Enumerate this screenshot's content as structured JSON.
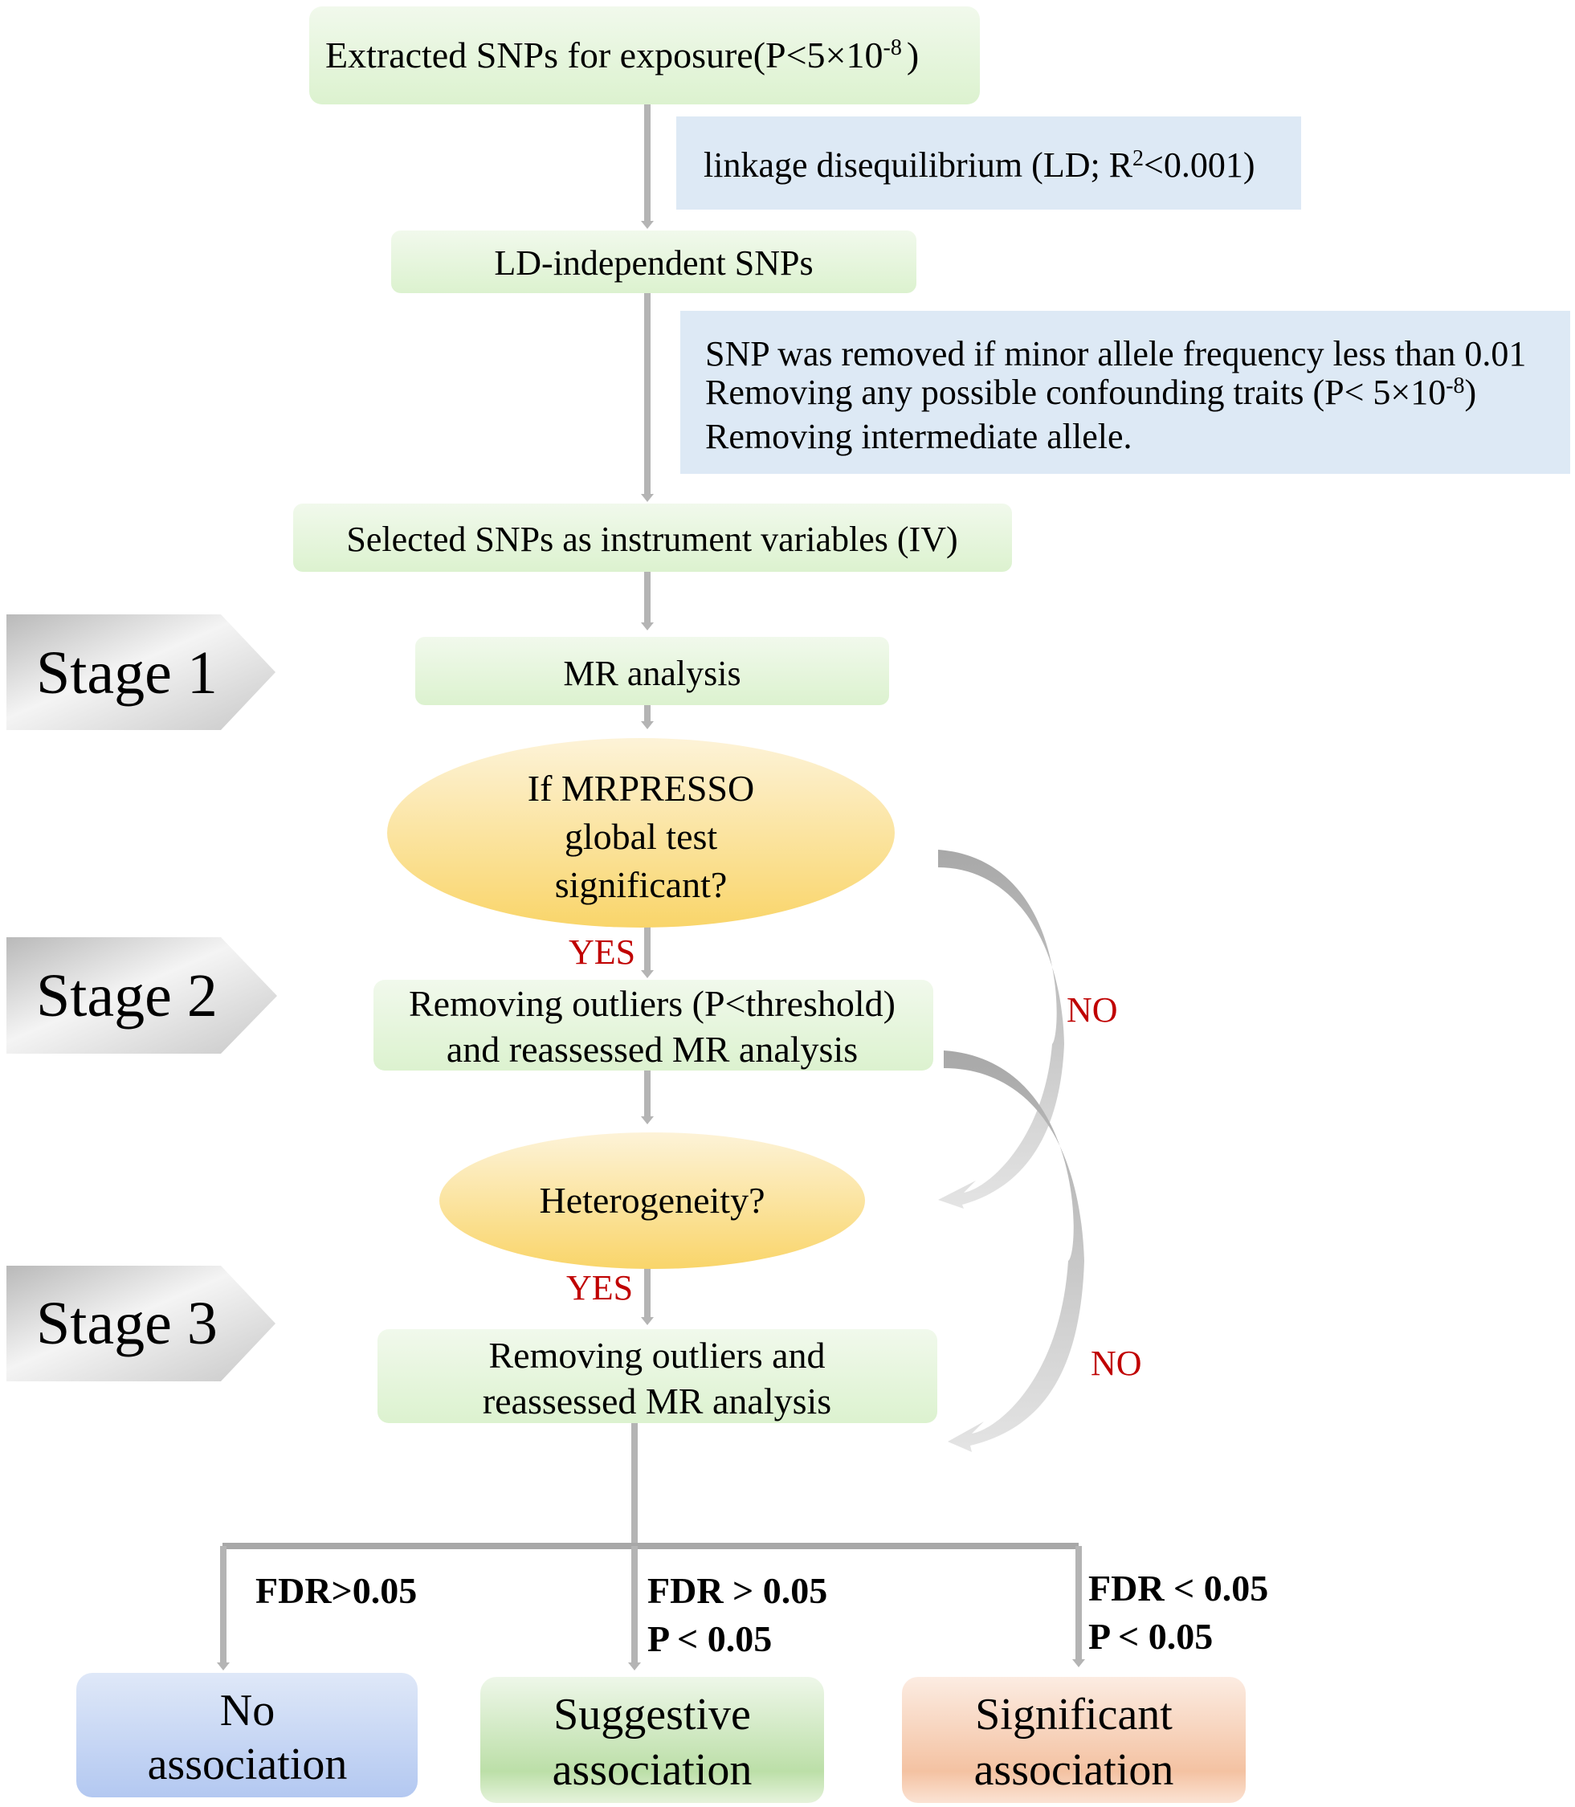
{
  "flow": {
    "extract": {
      "text": "Extracted SNPs for exposure(P<5×10",
      "sup": "-8",
      "tail": ")"
    },
    "ld_note": {
      "text": "linkage disequilibrium (LD; R",
      "sup": "2",
      "tail": "<0.001)"
    },
    "ld_independent": "LD-independent SNPs",
    "filter_note": {
      "line1": "SNP was removed if minor allele frequency less than 0.01",
      "line2": {
        "text": "Removing any possible confounding traits (P< 5×10",
        "sup": "-8",
        "tail": ")"
      },
      "line3": "Removing intermediate allele."
    },
    "selected_iv": "Selected SNPs as instrument variables (IV)",
    "mr_analysis": "MR analysis",
    "mrpresso": {
      "line1": "If MRPRESSO",
      "line2": "global test",
      "line3": "significant?"
    },
    "yes1": "YES",
    "no1": "NO",
    "remove_outliers_1": {
      "line1": "Removing outliers (P<threshold)",
      "line2": "and reassessed MR analysis"
    },
    "heterogeneity": "Heterogeneity?",
    "yes2": "YES",
    "no2": "NO",
    "remove_outliers_2": {
      "line1": "Removing outliers and",
      "line2": "reassessed MR analysis"
    }
  },
  "stages": [
    "Stage 1",
    "Stage 2",
    "Stage 3"
  ],
  "branches": [
    {
      "cond1": "FDR>0.05",
      "cond2": "",
      "result1": "No",
      "result2": "association"
    },
    {
      "cond1": "FDR > 0.05",
      "cond2": "P < 0.05",
      "result1": "Suggestive",
      "result2": "association"
    },
    {
      "cond1": "FDR < 0.05",
      "cond2": "P < 0.05",
      "result1": "Significant",
      "result2": "association"
    }
  ],
  "colors": {
    "process_box": "#e3f4d8",
    "note_box": "#dde9f5",
    "decision": "#fbd971",
    "arrow": "#b4b4b4",
    "label_red": "#c00000",
    "no_assoc": "#b8cbf0",
    "suggestive": "#bfe0ab",
    "significant": "#f6c6a6"
  }
}
